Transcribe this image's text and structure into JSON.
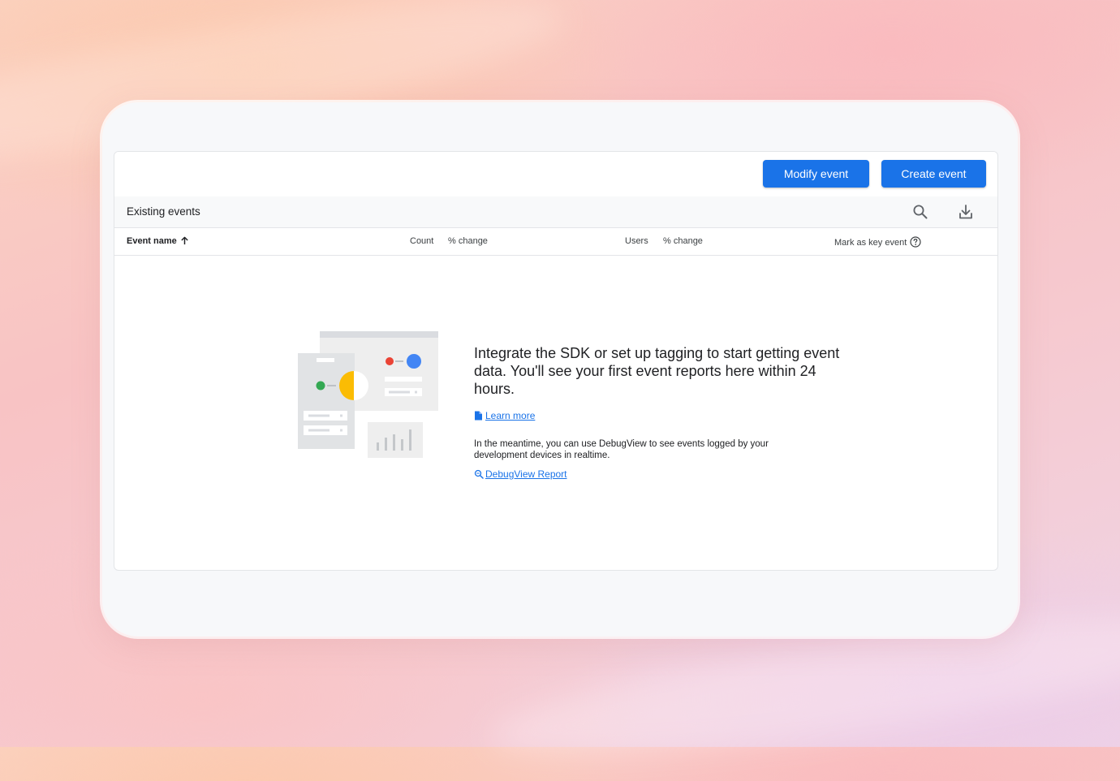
{
  "toolbar": {
    "modify_label": "Modify event",
    "create_label": "Create event"
  },
  "subheader": {
    "title": "Existing events",
    "icons": [
      "search-icon",
      "download-icon"
    ]
  },
  "table": {
    "columns": [
      "Event name",
      "Count",
      "% change",
      "Users",
      "% change",
      "Mark as key event"
    ],
    "sort": {
      "column": "Event name",
      "direction": "ascending"
    }
  },
  "empty_state": {
    "heading": "Integrate the SDK or set up tagging to start getting event data. You'll see your first event reports here within 24 hours.",
    "learn_more_label": "Learn more",
    "meantime_text": "In the meantime, you can use DebugView to see events logged by your development devices in realtime.",
    "debugview_label": "DebugView Report"
  },
  "colors": {
    "accent": "#1a73e8",
    "illustration_green": "#34a853",
    "illustration_yellow": "#fbbc04",
    "illustration_red": "#ea4335",
    "illustration_blue": "#4285f4"
  }
}
